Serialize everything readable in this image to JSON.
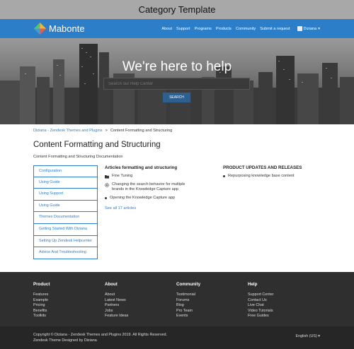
{
  "topbar": {
    "title": "Category Template"
  },
  "header": {
    "brand": "Mabonte",
    "nav": [
      "About",
      "Support",
      "Programs",
      "Products",
      "Community",
      "Submit a request"
    ],
    "user": "Diziana",
    "colors": {
      "header": "#2d7ec9"
    }
  },
  "hero": {
    "title": "We're here to help",
    "search_placeholder": "Search our Help Center",
    "search_button": "SEARCH"
  },
  "breadcrumb": {
    "items": [
      "Diziana - Zendesk Themes and Plugins",
      "Content Formatting and Structuring"
    ],
    "separator": ">"
  },
  "page": {
    "title": "Content Formatting and Structuring",
    "description": "Content Formatting and Structuring Documentation"
  },
  "categories": [
    "Configuration",
    "Using Guide",
    "Using Support",
    "Using Guide",
    "Themes Documentation",
    "Getting Started With Diziana",
    "Setting Up Zendesk Helpcenter",
    "Advice And Troubleshooting"
  ],
  "section_articles": {
    "title": "Articles formatting and structuring",
    "articles": [
      {
        "icon": "folder-icon",
        "text": "Fine Tuning"
      },
      {
        "icon": "target-icon",
        "text": "Changing the search behavior for multiple brands in the Knowledge Capture app"
      },
      {
        "icon": "bullet",
        "text": "Opening the Knowledge Capture app"
      }
    ],
    "see_all": "See all 17 articles"
  },
  "section_updates": {
    "title": "PRODUCT UPDATES AND RELEASES",
    "articles": [
      "Repurposing knowledge base content"
    ]
  },
  "footer": {
    "columns": [
      {
        "title": "Product",
        "links": [
          "Features",
          "Example",
          "Pricing",
          "Benefits",
          "Toolkits"
        ]
      },
      {
        "title": "About",
        "links": [
          "About",
          "Latest News",
          "Partners",
          "Jobs",
          "Feature Ideas"
        ]
      },
      {
        "title": "Community",
        "links": [
          "Testimonial",
          "Forums",
          "Blog",
          "Pro Team",
          "Events"
        ]
      },
      {
        "title": "Help",
        "links": [
          "Support Center",
          "Contact Us",
          "Live Chat",
          "Video Tutorials",
          "Free Guides"
        ]
      }
    ],
    "copyright": "Copyright © Diziana - Zendesk Themes and Plugins 2019. All Rights Reserved.",
    "designed_by": "Zendesk Theme Designed by Diziana",
    "language": "English (US)"
  }
}
